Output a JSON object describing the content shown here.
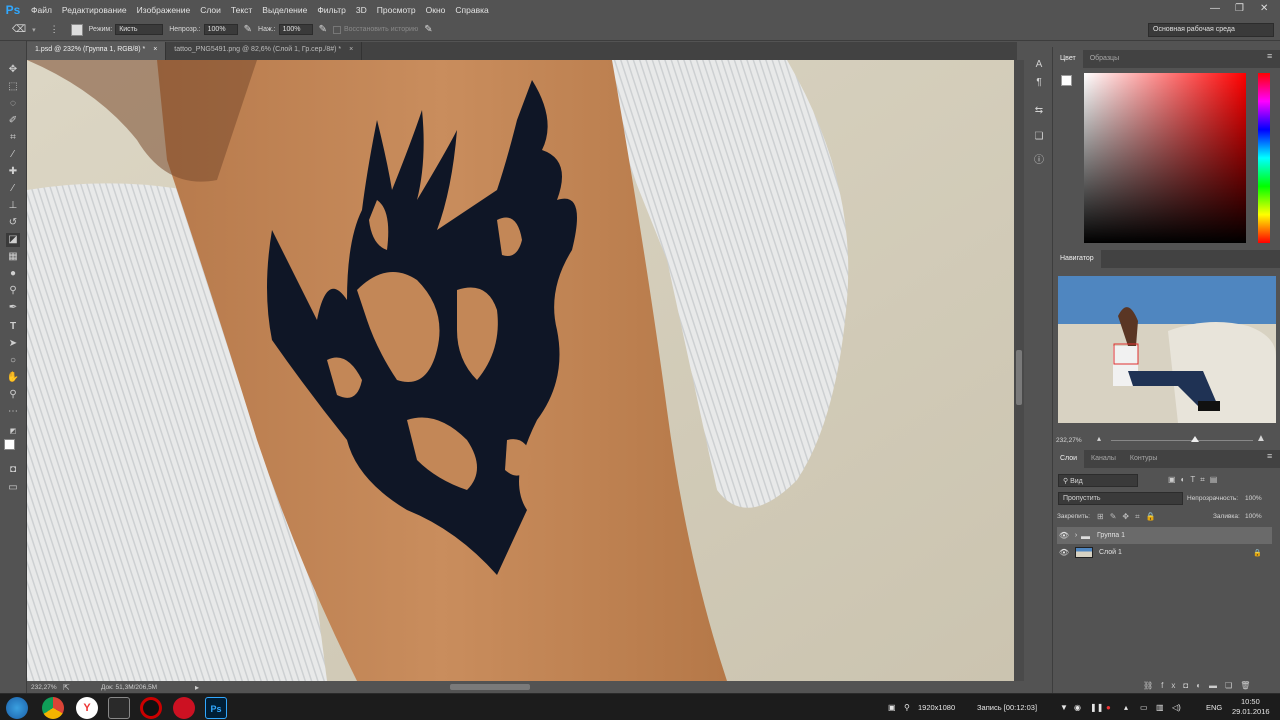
{
  "app": {
    "logo": "Ps"
  },
  "menu": [
    "Файл",
    "Редактирование",
    "Изображение",
    "Слои",
    "Текст",
    "Выделение",
    "Фильтр",
    "3D",
    "Просмотр",
    "Окно",
    "Справка"
  ],
  "options": {
    "mode_label": "Режим:",
    "mode_value": "Кисть",
    "opacity_label": "Непрозр.:",
    "opacity_value": "100%",
    "pressure_label": "Наж.:",
    "pressure_value": "100%",
    "erase_history_label": "Восстановить историю",
    "workspace": "Основная рабочая среда"
  },
  "tabs": [
    {
      "label": "1.psd @ 232% (Группа 1, RGB/8) *",
      "close": "×",
      "active": true
    },
    {
      "label": "tattoo_PNG5491.png @ 82,6% (Слой 1, Гр.сер./8#) *",
      "close": "×",
      "active": false
    }
  ],
  "status": {
    "zoom": "232,27%",
    "doc": "Док: 51,3M/206,5M"
  },
  "panels": {
    "color_tabs": [
      "Цвет",
      "Образцы"
    ],
    "navigator_title": "Навигатор",
    "navigator_zoom": "232,27%",
    "layers_tabs": [
      "Слои",
      "Каналы",
      "Контуры"
    ],
    "filter_kind": "Вид",
    "blend_mode": "Пропустить",
    "opacity_label": "Непрозрачность:",
    "opacity_value": "100%",
    "lock_label": "Закрепить:",
    "fill_label": "Заливка:",
    "fill_value": "100%",
    "layers": [
      {
        "name": "Группа 1",
        "type": "group",
        "selected": true
      },
      {
        "name": "Слой 1",
        "type": "pixel",
        "locked": true
      }
    ]
  },
  "taskbar": {
    "resolution": "1920x1080",
    "recording": "Запись [00:12:03]",
    "lang": "ENG",
    "time": "10:50",
    "date": "29.01.2016"
  },
  "colors": {
    "accent": "#31a8ff",
    "panel_bg": "#535353",
    "dark_bg": "#424242",
    "selection": "#6a6a6a"
  }
}
